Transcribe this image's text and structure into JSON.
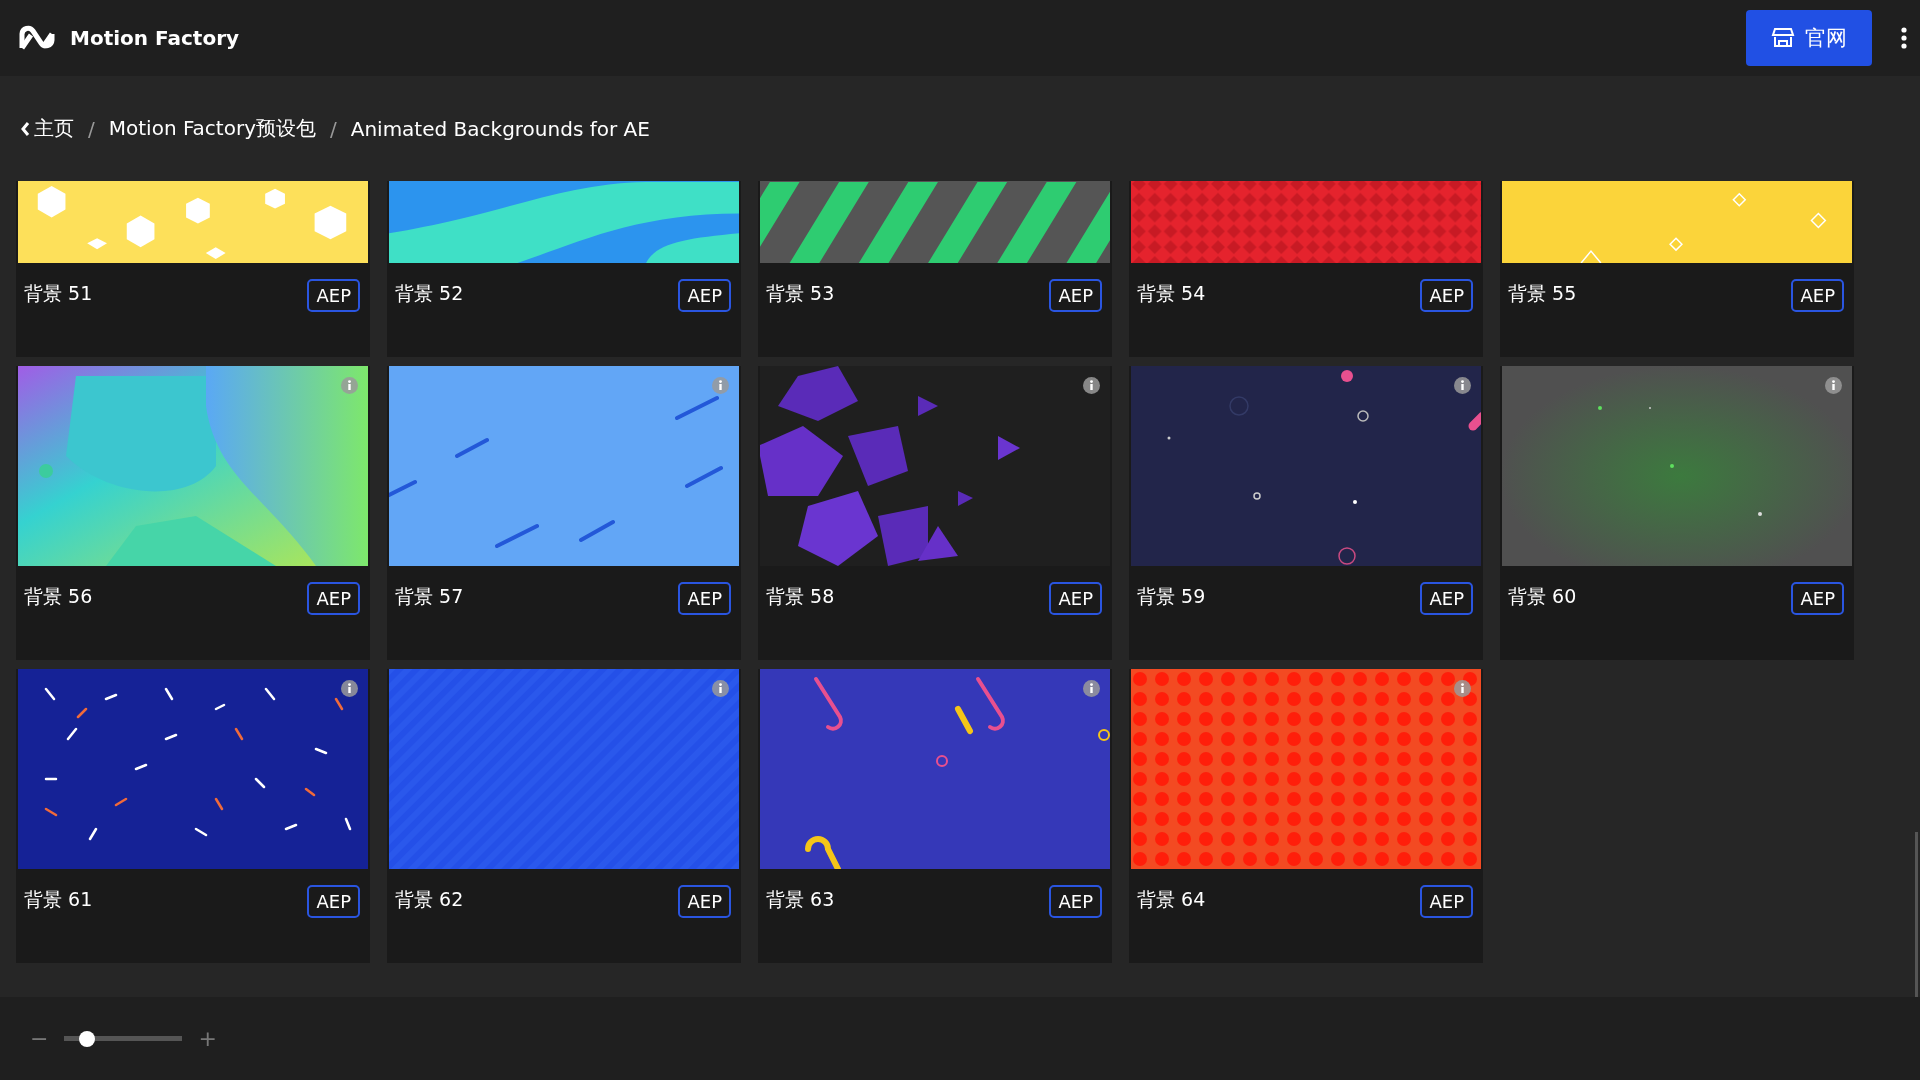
{
  "header": {
    "title": "Motion Factory",
    "button": "官网"
  },
  "breadcrumb": [
    {
      "kind": "back",
      "text": "主页"
    },
    {
      "kind": "separator",
      "text": "/"
    },
    {
      "kind": "link",
      "text": "Motion Factory预设包"
    },
    {
      "kind": "separator",
      "text": "/"
    },
    {
      "kind": "current",
      "text": "Animated Backgrounds for AE"
    }
  ],
  "cards": [
    {
      "title": "背景 51",
      "format": "AEP",
      "info": false
    },
    {
      "title": "背景 52",
      "format": "AEP",
      "info": false
    },
    {
      "title": "背景 53",
      "format": "AEP",
      "info": false
    },
    {
      "title": "背景 54",
      "format": "AEP",
      "info": false
    },
    {
      "title": "背景 55",
      "format": "AEP",
      "info": false
    },
    {
      "title": "背景 56",
      "format": "AEP",
      "info": true
    },
    {
      "title": "背景 57",
      "format": "AEP",
      "info": true
    },
    {
      "title": "背景 58",
      "format": "AEP",
      "info": true
    },
    {
      "title": "背景 59",
      "format": "AEP",
      "info": true
    },
    {
      "title": "背景 60",
      "format": "AEP",
      "info": true
    },
    {
      "title": "背景 61",
      "format": "AEP",
      "info": true
    },
    {
      "title": "背景 62",
      "format": "AEP",
      "info": true
    },
    {
      "title": "背景 63",
      "format": "AEP",
      "info": true
    },
    {
      "title": "背景 64",
      "format": "AEP",
      "info": true
    }
  ],
  "zoom": {
    "minus": "−",
    "plus": "+",
    "level": 0.23
  }
}
